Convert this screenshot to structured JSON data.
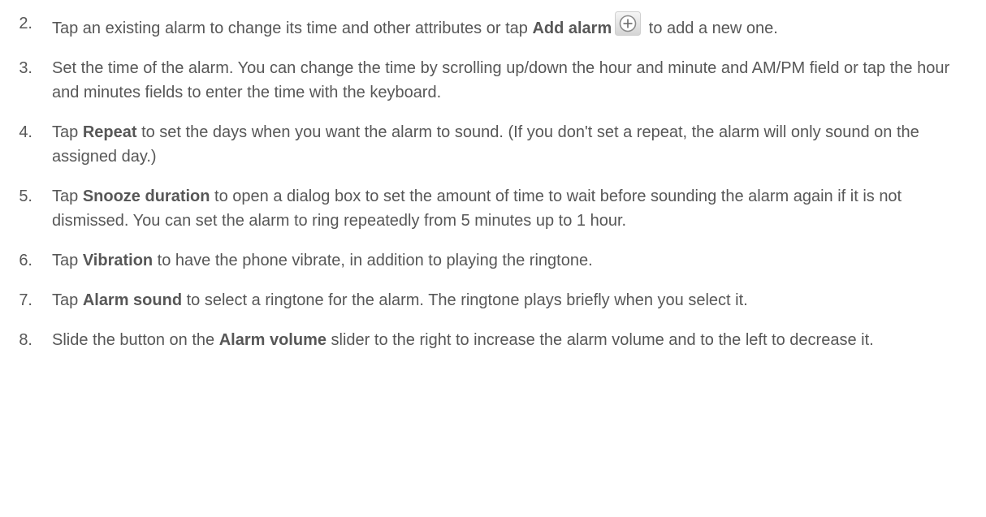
{
  "steps": [
    {
      "number": "2.",
      "parts": [
        "Tap an existing alarm to change its time and other attributes or tap ",
        "Add alarm",
        " to add a new one."
      ],
      "icon": "add-circle-icon"
    },
    {
      "number": "3.",
      "text": "Set the time of the alarm. You can change the time by scrolling up/down the hour and minute and AM/PM field or tap the hour and minutes fields to enter the time with the keyboard."
    },
    {
      "number": "4.",
      "parts": [
        "Tap ",
        "Repeat",
        " to set the days when you want the alarm to sound. (If you don't set a repeat, the alarm will only sound on the assigned day.)"
      ]
    },
    {
      "number": "5.",
      "parts": [
        "Tap ",
        "Snooze duration",
        " to open a dialog box to set the amount of time to wait before sounding the alarm again if it is not dismissed. You can set the alarm to ring repeatedly from 5 minutes up to 1 hour."
      ]
    },
    {
      "number": "6.",
      "parts": [
        "Tap ",
        "Vibration",
        " to have the phone vibrate, in addition to playing the ringtone."
      ]
    },
    {
      "number": "7.",
      "parts": [
        "Tap ",
        "Alarm sound",
        " to select a ringtone for the alarm. The ringtone plays briefly when you select it."
      ]
    },
    {
      "number": "8.",
      "parts": [
        "Slide the button on the ",
        "Alarm volume",
        " slider to the right to increase the alarm volume and to the left to decrease it."
      ]
    }
  ],
  "colors": {
    "text": "#575757",
    "icon_fill": "#e6e6e6",
    "icon_ring": "#8a8a8a",
    "icon_plus": "#6a6a6a"
  }
}
